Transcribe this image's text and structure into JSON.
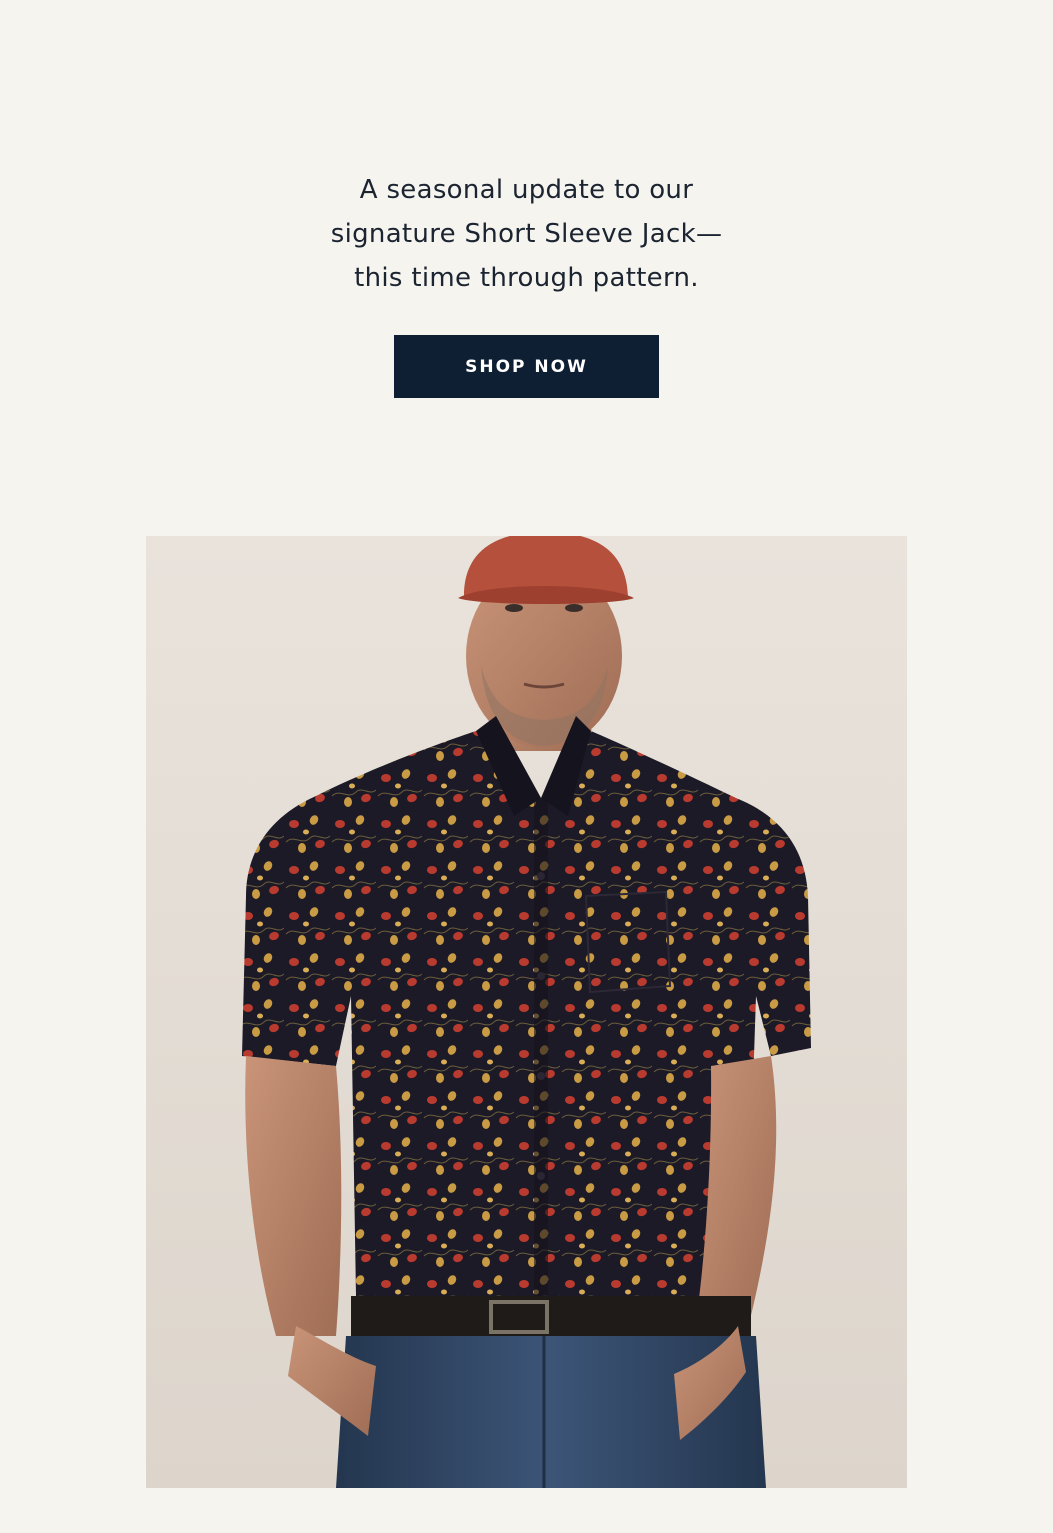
{
  "intro": {
    "lines": [
      "A seasonal update to our",
      "signature Short Sleeve Jack—",
      "this time through pattern."
    ]
  },
  "cta": {
    "label": "SHOP NOW"
  },
  "colors": {
    "page_background": "#f5f4ef",
    "text": "#1b2430",
    "button_background": "#0e1f33",
    "button_text": "#ffffff",
    "photo_backdrop": "#e7e1da",
    "cap": "#b5503c",
    "shirt": "#1c1a26",
    "print_red": "#b93a2e",
    "print_gold": "#c99b44",
    "denim": "#2f4566"
  },
  "photo": {
    "icon": "product-photo",
    "subject": "man-in-floral-short-sleeve-shirt-icon"
  }
}
